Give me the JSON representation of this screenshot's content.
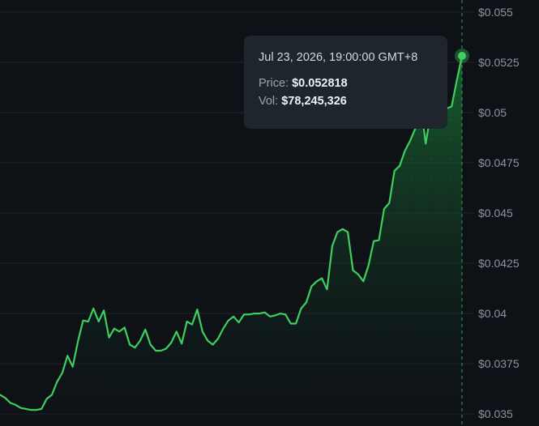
{
  "colors": {
    "background": "#0e1217",
    "gridline": "#1e242b",
    "line": "#3ecf5e",
    "area_top": "#1a6e34",
    "crosshair": "#2e9c4a",
    "tooltip_bg": "#1f252d"
  },
  "tooltip": {
    "time": "Jul 23, 2026, 19:00:00 GMT+8",
    "price_label": "Price:",
    "price_value": "$0.052818",
    "vol_label": "Vol:",
    "vol_value": "$78,245,326"
  },
  "chart_data": {
    "type": "area",
    "title": "",
    "xlabel": "",
    "ylabel": "",
    "ylim": [
      0.0344,
      0.0556
    ],
    "y_axis_position": "right",
    "grid": true,
    "y_ticks": [
      {
        "value": 0.055,
        "label": "$0.055"
      },
      {
        "value": 0.0525,
        "label": "$0.0525"
      },
      {
        "value": 0.05,
        "label": "$0.05"
      },
      {
        "value": 0.0475,
        "label": "$0.0475"
      },
      {
        "value": 0.045,
        "label": "$0.045"
      },
      {
        "value": 0.0425,
        "label": "$0.0425"
      },
      {
        "value": 0.04,
        "label": "$0.04"
      },
      {
        "value": 0.0375,
        "label": "$0.0375"
      },
      {
        "value": 0.035,
        "label": "$0.035"
      }
    ],
    "series": [
      {
        "values": [
          0.03595,
          0.0358,
          0.03555,
          0.03545,
          0.0353,
          0.03525,
          0.0352,
          0.0352,
          0.03525,
          0.03575,
          0.03595,
          0.0366,
          0.03705,
          0.0379,
          0.03735,
          0.0386,
          0.03965,
          0.0396,
          0.04025,
          0.0396,
          0.04015,
          0.0388,
          0.03925,
          0.0391,
          0.0393,
          0.03845,
          0.0383,
          0.03865,
          0.0392,
          0.03845,
          0.03815,
          0.03815,
          0.03825,
          0.03855,
          0.0391,
          0.0385,
          0.0396,
          0.03945,
          0.0402,
          0.0391,
          0.03865,
          0.03845,
          0.03875,
          0.03925,
          0.03965,
          0.03985,
          0.03955,
          0.03995,
          0.03995,
          0.04,
          0.04,
          0.04005,
          0.03985,
          0.0399,
          0.04,
          0.03995,
          0.0395,
          0.0395,
          0.04025,
          0.04055,
          0.04135,
          0.0416,
          0.04175,
          0.0412,
          0.04335,
          0.04405,
          0.0442,
          0.04405,
          0.04215,
          0.04195,
          0.0416,
          0.0424,
          0.0436,
          0.04365,
          0.0452,
          0.0455,
          0.0471,
          0.04735,
          0.0481,
          0.0486,
          0.0492,
          0.0505,
          0.04845,
          0.05,
          0.0505,
          0.0506,
          0.0502,
          0.0503,
          0.0516,
          0.05282
        ]
      }
    ],
    "highlight_value": 0.052818
  }
}
